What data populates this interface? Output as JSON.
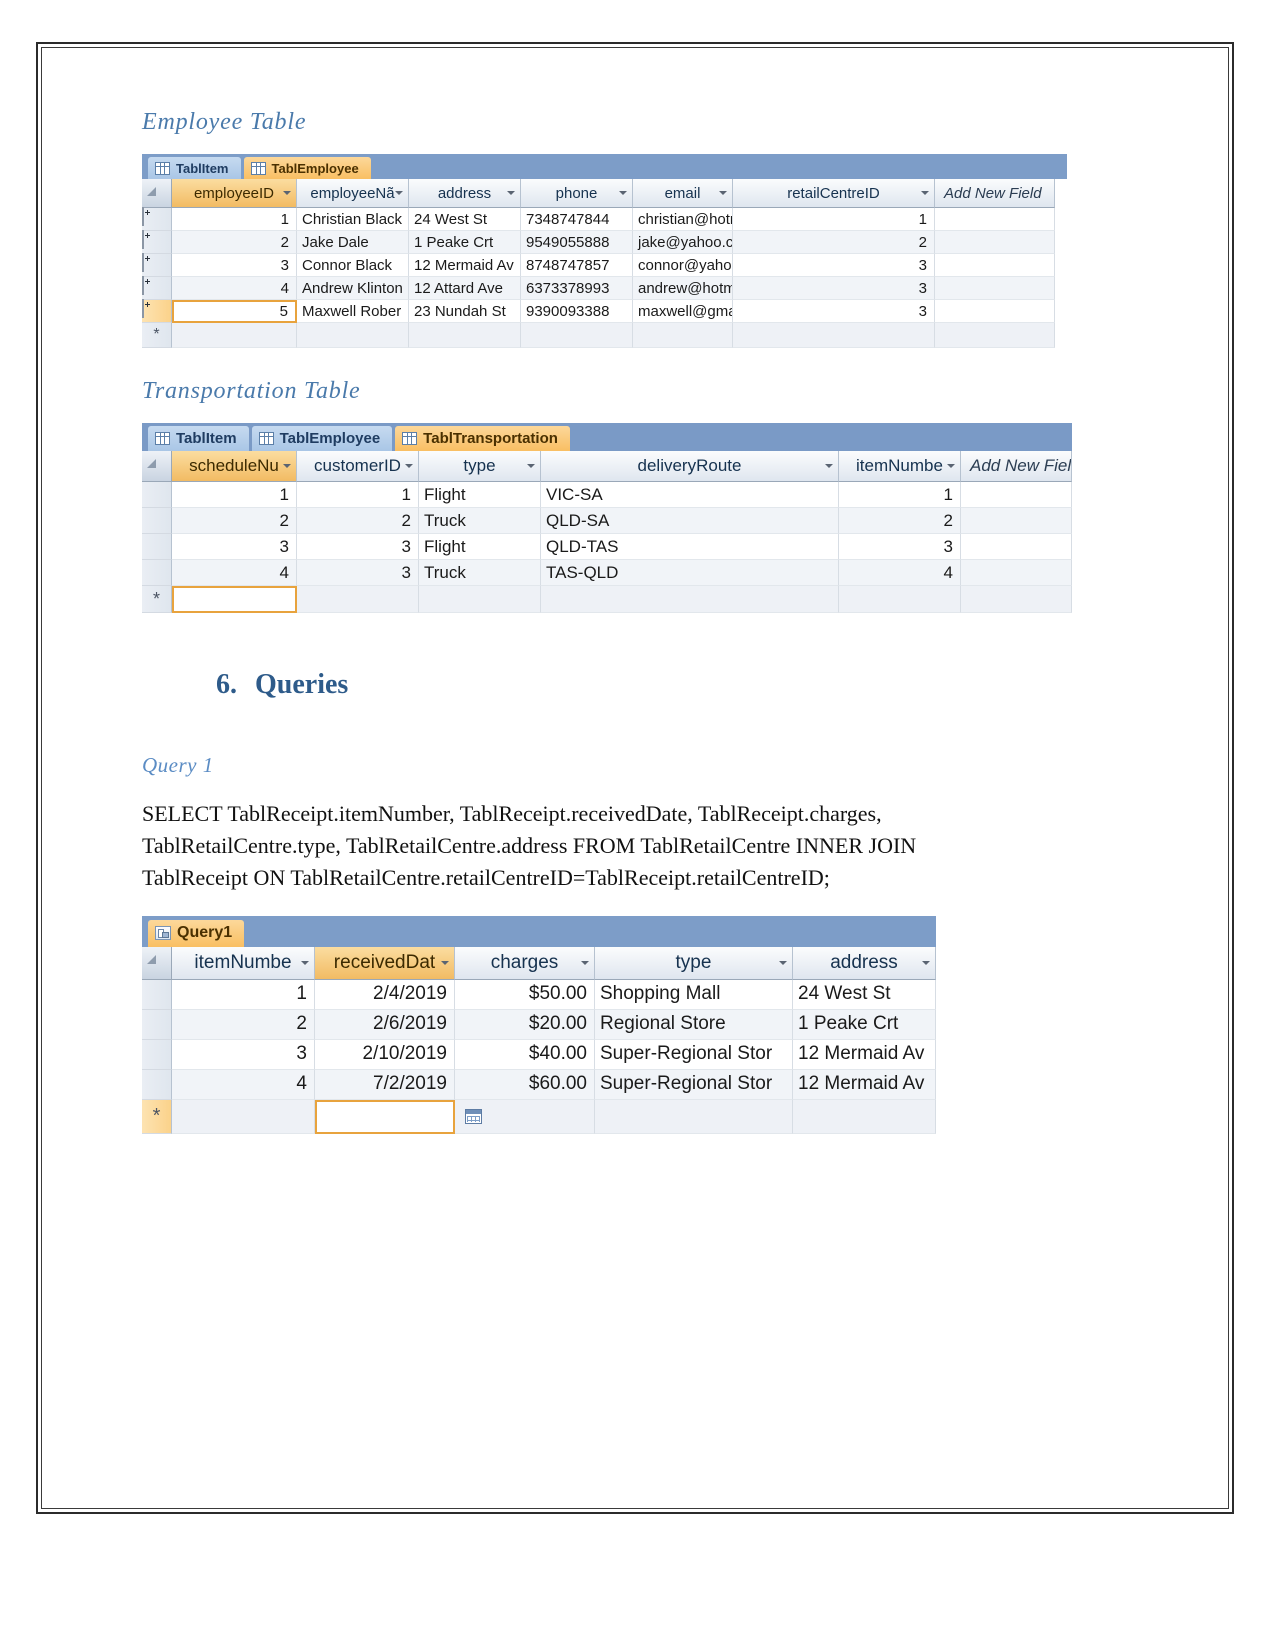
{
  "document": {
    "sections": {
      "employee_heading": "Employee Table",
      "transportation_heading": "Transportation Table",
      "queries_number": "6.",
      "queries_heading": "Queries",
      "query1_heading": "Query 1"
    },
    "sql": {
      "line1": "SELECT TablReceipt.itemNumber, TablReceipt.receivedDate, TablReceipt.charges,",
      "line2": "TablRetailCentre.type, TablRetailCentre.address FROM TablRetailCentre INNER JOIN",
      "line3": "TablReceipt ON TablRetailCentre.retailCentreID=TablReceipt.retailCentreID;"
    }
  },
  "employee_sheet": {
    "tabs": [
      {
        "label": "TablItem",
        "active": false,
        "icon": "table-grid-icon"
      },
      {
        "label": "TablEmployee",
        "active": true,
        "icon": "table-grid-icon"
      }
    ],
    "columns": [
      {
        "label": "employeeID",
        "selected": true
      },
      {
        "label": "employeeNã",
        "selected": false
      },
      {
        "label": "address",
        "selected": false
      },
      {
        "label": "phone",
        "selected": false
      },
      {
        "label": "email",
        "selected": false
      },
      {
        "label": "retailCentreID",
        "selected": false
      }
    ],
    "add_new_field": "Add New Field",
    "rows": [
      {
        "employeeID": "1",
        "employeeName": "Christian Black",
        "address": "24 West St",
        "phone": "7348747844",
        "email": "christian@hotm",
        "retailCentreID": "1"
      },
      {
        "employeeID": "2",
        "employeeName": "Jake Dale",
        "address": "1 Peake Crt",
        "phone": "9549055888",
        "email": "jake@yahoo.co",
        "retailCentreID": "2"
      },
      {
        "employeeID": "3",
        "employeeName": "Connor Black",
        "address": "12 Mermaid Av",
        "phone": "8748747857",
        "email": "connor@yahoo",
        "retailCentreID": "3"
      },
      {
        "employeeID": "4",
        "employeeName": "Andrew Klinton",
        "address": "12 Attard Ave",
        "phone": "6373378993",
        "email": "andrew@hotm",
        "retailCentreID": "3"
      },
      {
        "employeeID": "5",
        "employeeName": "Maxwell Rober",
        "address": "23 Nundah St",
        "phone": "9390093388",
        "email": "maxwell@gma",
        "retailCentreID": "3"
      }
    ],
    "new_record_marker": "*"
  },
  "transportation_sheet": {
    "tabs": [
      {
        "label": "TablItem",
        "active": false,
        "icon": "table-grid-icon"
      },
      {
        "label": "TablEmployee",
        "active": false,
        "icon": "table-grid-icon"
      },
      {
        "label": "TablTransportation",
        "active": true,
        "icon": "table-grid-icon"
      }
    ],
    "columns": [
      {
        "label": "scheduleNu",
        "selected": true
      },
      {
        "label": "customerID",
        "selected": false
      },
      {
        "label": "type",
        "selected": false
      },
      {
        "label": "deliveryRoute",
        "selected": false
      },
      {
        "label": "itemNumbe",
        "selected": false
      }
    ],
    "add_new_field": "Add New Field",
    "rows": [
      {
        "scheduleNumber": "1",
        "customerID": "1",
        "type": "Flight",
        "deliveryRoute": "VIC-SA",
        "itemNumber": "1"
      },
      {
        "scheduleNumber": "2",
        "customerID": "2",
        "type": "Truck",
        "deliveryRoute": "QLD-SA",
        "itemNumber": "2"
      },
      {
        "scheduleNumber": "3",
        "customerID": "3",
        "type": "Flight",
        "deliveryRoute": "QLD-TAS",
        "itemNumber": "3"
      },
      {
        "scheduleNumber": "4",
        "customerID": "3",
        "type": "Truck",
        "deliveryRoute": "TAS-QLD",
        "itemNumber": "4"
      }
    ],
    "new_record_marker": "*"
  },
  "query1_sheet": {
    "tabs": [
      {
        "label": "Query1",
        "active": true,
        "icon": "query-icon"
      }
    ],
    "columns": [
      {
        "label": "itemNumbe",
        "selected": false
      },
      {
        "label": "receivedDat",
        "selected": true
      },
      {
        "label": "charges",
        "selected": false
      },
      {
        "label": "type",
        "selected": false
      },
      {
        "label": "address",
        "selected": false
      }
    ],
    "rows": [
      {
        "itemNumber": "1",
        "receivedDate": "2/4/2019",
        "charges": "$50.00",
        "type": "Shopping Mall",
        "address": "24 West St"
      },
      {
        "itemNumber": "2",
        "receivedDate": "2/6/2019",
        "charges": "$20.00",
        "type": "Regional Store",
        "address": "1 Peake Crt"
      },
      {
        "itemNumber": "3",
        "receivedDate": "2/10/2019",
        "charges": "$40.00",
        "type": "Super-Regional Stor",
        "address": "12 Mermaid Av"
      },
      {
        "itemNumber": "4",
        "receivedDate": "7/2/2019",
        "charges": "$60.00",
        "type": "Super-Regional Stor",
        "address": "12 Mermaid Av"
      }
    ],
    "new_record_marker": "*"
  },
  "colors": {
    "accent_heading": "#4a7aab",
    "section_heading": "#2e5b8a",
    "tab_active": "#f9bf63",
    "tab_inactive": "#a9c6e6",
    "tabbar_bg": "#7d9dc8",
    "selection_orange": "#e8a33d"
  }
}
